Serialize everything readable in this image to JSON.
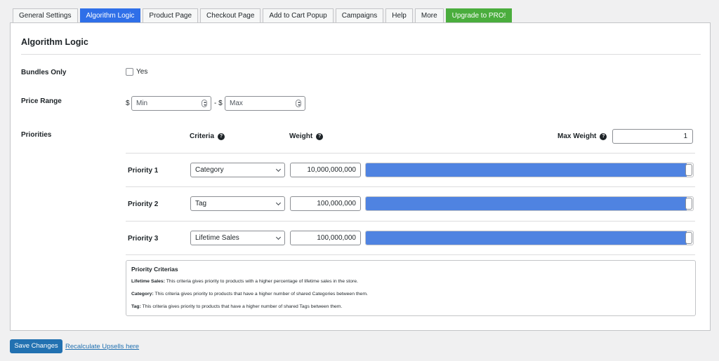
{
  "tabs": [
    {
      "label": "General Settings"
    },
    {
      "label": "Algorithm Logic"
    },
    {
      "label": "Product Page"
    },
    {
      "label": "Checkout Page"
    },
    {
      "label": "Add to Cart Popup"
    },
    {
      "label": "Campaigns"
    },
    {
      "label": "Help"
    },
    {
      "label": "More"
    },
    {
      "label": "Upgrade to PRO!"
    }
  ],
  "active_tab": "Algorithm Logic",
  "section_title": "Algorithm Logic",
  "bundles": {
    "label": "Bundles Only",
    "checkbox_label": "Yes",
    "checked": false
  },
  "price_range": {
    "label": "Price Range",
    "currency": "$",
    "separator": "- $",
    "min_placeholder": "Min",
    "max_placeholder": "Max"
  },
  "priorities": {
    "label": "Priorities",
    "criteria_header": "Criteria",
    "weight_header": "Weight",
    "max_weight_label": "Max Weight",
    "max_weight_value": "1",
    "rows": [
      {
        "label": "Priority 1",
        "criteria": "Category",
        "weight": "10,000,000,000",
        "slider_level": 1.0
      },
      {
        "label": "Priority 2",
        "criteria": "Tag",
        "weight": "100,000,000",
        "slider_level": 1.0
      },
      {
        "label": "Priority 3",
        "criteria": "Lifetime Sales",
        "weight": "100,000,000",
        "slider_level": 1.0
      }
    ]
  },
  "criteria_info": {
    "title": "Priority Criterias",
    "items": [
      {
        "name": "Lifetime Sales:",
        "text": " This criteria gives priority to products with a higher percentage of lifetime sales in the store."
      },
      {
        "name": "Category:",
        "text": " This criteria gives priority to products that have a higher number of shared Categories between them."
      },
      {
        "name": "Tag:",
        "text": " This criteria gives priority to products that have a higher number of shared Tags between them."
      }
    ]
  },
  "footer": {
    "save_label": "Save Changes",
    "recalc_link": "Recalculate Upsells here"
  },
  "colors": {
    "active_tab": "#2f6fe8",
    "pro_tab": "#4aad3d",
    "slider_fill": "#4f83e1",
    "primary_button": "#2271b1"
  },
  "icons": {
    "help": "question-circle-icon",
    "dropdown": "chevron-down-icon",
    "spinner": "number-spinner-icon"
  }
}
